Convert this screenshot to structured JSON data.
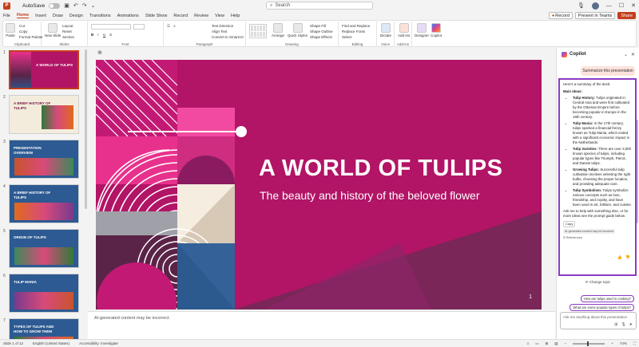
{
  "titlebar": {
    "autosave_label": "AutoSave",
    "search_placeholder": "Search",
    "file_name": ""
  },
  "menu_tabs": [
    "File",
    "Home",
    "Insert",
    "Draw",
    "Design",
    "Transitions",
    "Animations",
    "Slide Show",
    "Record",
    "Review",
    "View",
    "Help"
  ],
  "tab_actions": {
    "record_label": "Record",
    "present_label": "Present in Teams",
    "share_label": "Share"
  },
  "ribbon": {
    "clipboard": {
      "label": "Clipboard",
      "paste": "Paste",
      "cut": "Cut",
      "copy": "Copy",
      "format_painter": "Format Painter"
    },
    "slides": {
      "label": "Slides",
      "new_slide": "New Slide",
      "layout": "Layout",
      "reset": "Reset",
      "section": "Section"
    },
    "font": {
      "label": "Font"
    },
    "paragraph": {
      "label": "Paragraph",
      "text_direction": "Text Direction",
      "align_text": "Align Text",
      "smartart": "Convert to SmartArt"
    },
    "drawing": {
      "label": "Drawing",
      "arrange": "Arrange",
      "quick_styles": "Quick Styles",
      "shape_fill": "Shape Fill",
      "shape_outline": "Shape Outline",
      "shape_effects": "Shape Effects"
    },
    "editing": {
      "label": "Editing",
      "find": "Find and Replace",
      "replace_fonts": "Replace Fonts",
      "select": "Select"
    },
    "voice": {
      "label": "Voice",
      "dictate": "Dictate"
    },
    "addins": {
      "label": "Add-ins",
      "addins": "Add-ins"
    },
    "designer": {
      "designer": "Designer"
    },
    "copilot": {
      "copilot": "Copilot"
    }
  },
  "slides": [
    {
      "num": "1",
      "title": "A WORLD OF TULIPS",
      "bg": "#b21466",
      "active": true
    },
    {
      "num": "2",
      "title": "A BRIEF HISTORY OF TULIPS",
      "bg": "#f3ecdc",
      "active": false
    },
    {
      "num": "3",
      "title": "PRESENTATION OVERVIEW",
      "bg": "#2d5a92",
      "active": false
    },
    {
      "num": "4",
      "title": "A BRIEF HISTORY OF TULIPS",
      "bg": "#2d5a92",
      "active": false
    },
    {
      "num": "5",
      "title": "ORIGIN OF TULIPS",
      "bg": "#2d5a92",
      "active": false
    },
    {
      "num": "6",
      "title": "TULIP MANIA",
      "bg": "#2d5a92",
      "active": false
    },
    {
      "num": "7",
      "title": "TYPES OF TULIPS AND HOW TO GROW THEM",
      "bg": "#2d5a92",
      "active": false
    }
  ],
  "main_slide": {
    "title": "A WORLD OF TULIPS",
    "subtitle": "The beauty and history of the beloved flower",
    "number": "1"
  },
  "notes": {
    "text": "AI-generated content may be incorrect."
  },
  "copilot": {
    "title": "Copilot",
    "user_prompt": "Summarize this presentation",
    "intro": "Here's a summary of the deck:",
    "main_ideas_label": "Main ideas:",
    "bullets": [
      {
        "term": "Tulip History:",
        "text": "Tulips originated in Central Asia and were first cultivated by the Ottoman Empire before becoming popular in Europe in the 16th century."
      },
      {
        "term": "Tulip Mania:",
        "text": "In the 17th century, tulips sparked a financial frenzy known as Tulip Mania, which ended with a significant economic impact in the Netherlands."
      },
      {
        "term": "Tulip Varieties:",
        "text": "There are over 3,000 known species of tulips, including popular types like Triumph, Parrot, and Darwin tulips."
      },
      {
        "term": "Growing Tulips:",
        "text": "Successful tulip cultivation involves selecting the right bulbs, choosing the proper location, and providing adequate care."
      },
      {
        "term": "Tulip Symbolism:",
        "text": "Tulips symbolize various concepts such as love, friendship, and royalty, and have been used in art, folklore, and cuisine."
      }
    ],
    "closing": "Ask me to help with something else, or for more ideas see the prompt guide below.",
    "copy_label": "Copy",
    "disclaimer": "AI-generated content may be incorrect",
    "references": "5 References",
    "change_topic": "Change topic",
    "suggestions": [
      "How are tulips used in cooking?",
      "What are some popular types of tulips?"
    ],
    "input_placeholder": "Ask me anything about this presentation"
  },
  "statusbar": {
    "slide_info": "Slide 1 of 12",
    "language": "English (United States)",
    "accessibility": "Accessibility: Investigate",
    "zoom": "74%"
  }
}
